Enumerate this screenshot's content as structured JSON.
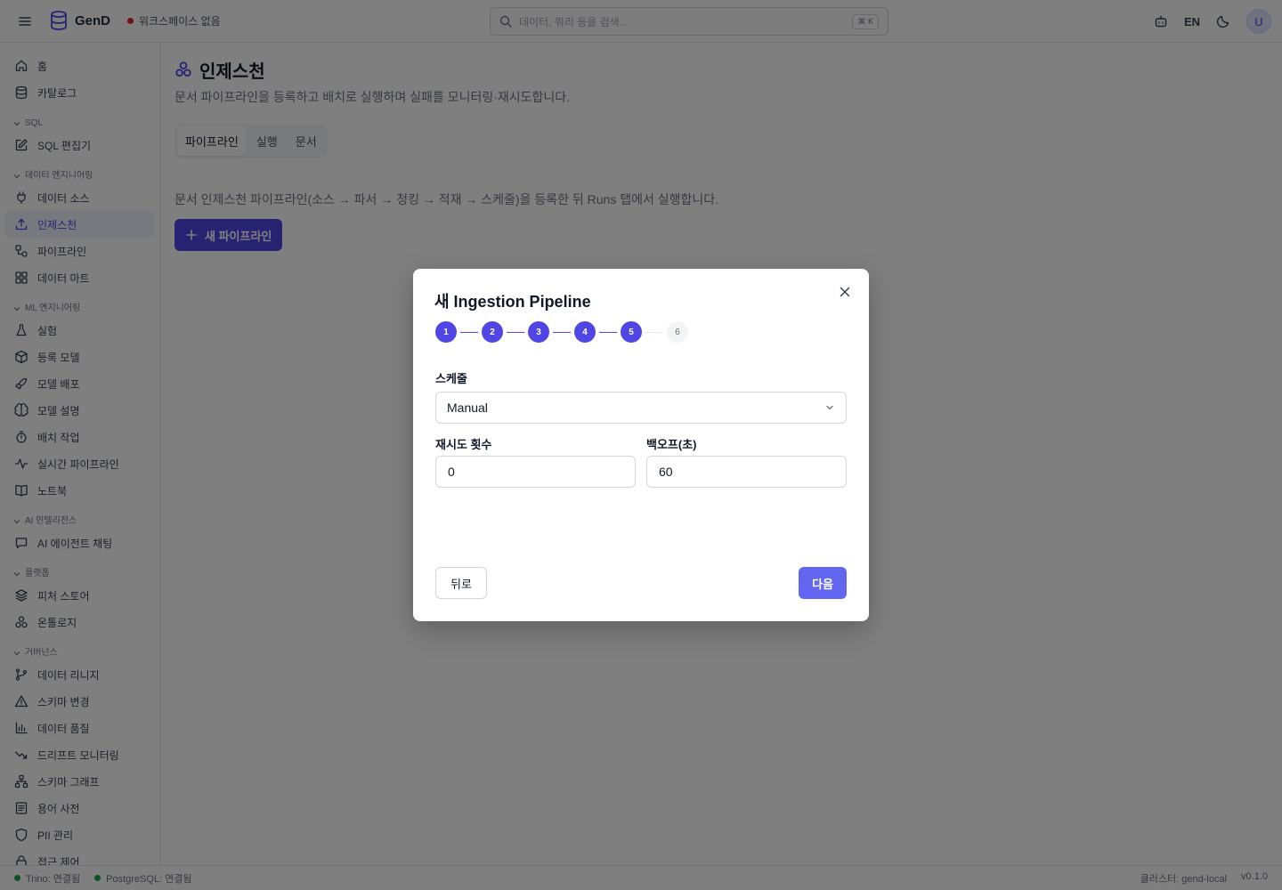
{
  "topbar": {
    "app_name": "GenD",
    "workspace_status": "워크스페이스 없음",
    "search_placeholder": "데이터, 쿼리 등을 검색...",
    "search_shortcut": "⌘ K",
    "language": "EN",
    "avatar_initial": "U"
  },
  "sidebar": {
    "top_items": [
      {
        "label": "홈",
        "icon": "home-icon"
      },
      {
        "label": "카탈로그",
        "icon": "database-icon"
      }
    ],
    "sections": [
      {
        "title": "SQL",
        "items": [
          {
            "label": "SQL 편집기",
            "icon": "edit-icon"
          }
        ]
      },
      {
        "title": "데이터 엔지니어링",
        "items": [
          {
            "label": "데이터 소스",
            "icon": "plug-icon"
          },
          {
            "label": "인제스천",
            "icon": "upload-icon",
            "active": true
          },
          {
            "label": "파이프라인",
            "icon": "workflow-icon"
          },
          {
            "label": "데이터 마트",
            "icon": "grid-icon"
          }
        ]
      },
      {
        "title": "ML 엔지니어링",
        "items": [
          {
            "label": "실험",
            "icon": "flask-icon"
          },
          {
            "label": "등록 모델",
            "icon": "package-icon"
          },
          {
            "label": "모델 배포",
            "icon": "rocket-icon"
          },
          {
            "label": "모델 설명",
            "icon": "brain-icon"
          },
          {
            "label": "배치 작업",
            "icon": "timer-icon"
          },
          {
            "label": "실시간 파이프라인",
            "icon": "activity-icon"
          },
          {
            "label": "노트북",
            "icon": "book-icon"
          }
        ]
      },
      {
        "title": "AI 인텔리전스",
        "items": [
          {
            "label": "AI 에이전트 채팅",
            "icon": "chat-icon"
          }
        ]
      },
      {
        "title": "플랫폼",
        "items": [
          {
            "label": "피처 스토어",
            "icon": "layers-icon"
          },
          {
            "label": "온톨로지",
            "icon": "ontology-icon"
          }
        ]
      },
      {
        "title": "거버넌스",
        "items": [
          {
            "label": "데이터 리니지",
            "icon": "branch-icon"
          },
          {
            "label": "스키마 변경",
            "icon": "warning-icon"
          },
          {
            "label": "데이터 품질",
            "icon": "bar-chart-icon"
          },
          {
            "label": "드리프트 모니터링",
            "icon": "trending-down-icon"
          },
          {
            "label": "스키마 그래프",
            "icon": "network-icon"
          },
          {
            "label": "용어 사전",
            "icon": "list-icon"
          },
          {
            "label": "PII 관리",
            "icon": "shield-icon"
          },
          {
            "label": "접근 제어",
            "icon": "lock-icon"
          }
        ]
      }
    ]
  },
  "main": {
    "title": "인제스천",
    "description": "문서 파이프라인을 등록하고 배치로 실행하며 실패를 모니터링·재시도합니다.",
    "tabs": [
      {
        "label": "파이프라인",
        "active": true
      },
      {
        "label": "실행",
        "active": false
      },
      {
        "label": "문서",
        "active": false
      }
    ],
    "pipeline_description": "문서 인제스천 파이프라인(소스 → 파서 → 청킹 → 적재 → 스케줄)을 등록한 뒤 Runs 탭에서 실행합니다.",
    "new_pipeline_label": "새 파이프라인"
  },
  "modal": {
    "title": "새 Ingestion Pipeline",
    "steps": [
      {
        "number": "1",
        "done": true
      },
      {
        "number": "2",
        "done": true
      },
      {
        "number": "3",
        "done": true
      },
      {
        "number": "4",
        "done": true
      },
      {
        "number": "5",
        "done": true
      },
      {
        "number": "6",
        "done": false
      }
    ],
    "schedule_label": "스케줄",
    "schedule_value": "Manual",
    "retry_label": "재시도 횟수",
    "retry_value": "0",
    "backoff_label": "백오프(초)",
    "backoff_value": "60",
    "back_label": "뒤로",
    "next_label": "다음"
  },
  "statusbar": {
    "trino_status": "Trino: 연결됨",
    "postgres_status": "PostgreSQL: 연결됨",
    "cluster": "클러스터: gend-local",
    "version": "v0.1.0"
  },
  "colors": {
    "accent": "#4f46e5",
    "status_ok": "#16a34a",
    "status_error": "#dc2626"
  }
}
